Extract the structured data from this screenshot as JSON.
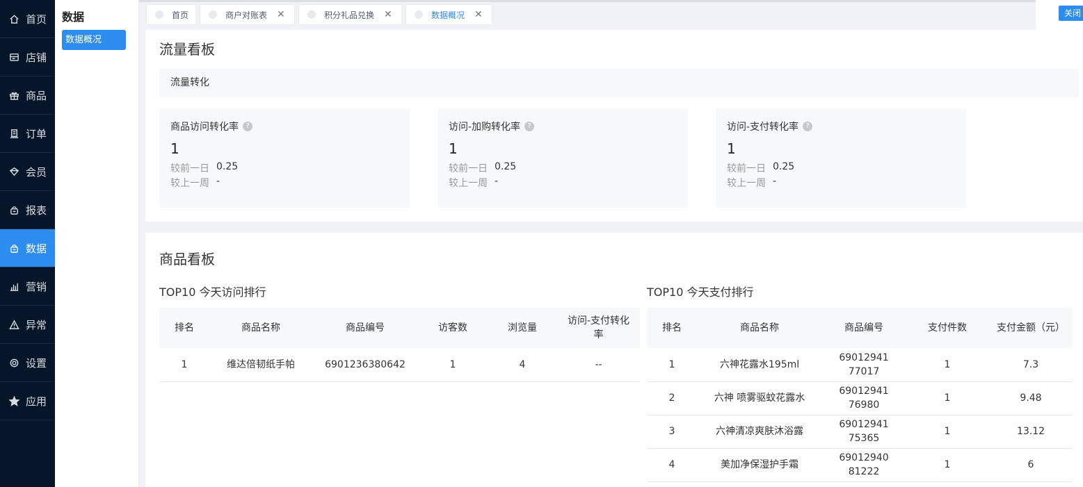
{
  "sidebar": {
    "items": [
      {
        "label": "首页",
        "icon": "home-icon"
      },
      {
        "label": "店铺",
        "icon": "store-icon"
      },
      {
        "label": "商品",
        "icon": "gift-icon"
      },
      {
        "label": "订单",
        "icon": "order-icon"
      },
      {
        "label": "会员",
        "icon": "member-icon"
      },
      {
        "label": "报表",
        "icon": "report-icon"
      },
      {
        "label": "数据",
        "icon": "data-icon",
        "active": true
      },
      {
        "label": "营销",
        "icon": "chart-bar-icon"
      },
      {
        "label": "异常",
        "icon": "warning-icon"
      },
      {
        "label": "设置",
        "icon": "gear-icon"
      },
      {
        "label": "应用",
        "icon": "star-icon"
      }
    ]
  },
  "subsidebar": {
    "title": "数据",
    "items": [
      {
        "label": "数据概况",
        "active": true
      }
    ]
  },
  "tabs": [
    {
      "label": "首页",
      "closable": false
    },
    {
      "label": "商户对账表",
      "closable": true
    },
    {
      "label": "积分礼品兑换",
      "closable": true
    },
    {
      "label": "数据概况",
      "closable": true,
      "active": true
    }
  ],
  "close_all_label": "关闭",
  "flow_board": {
    "title": "流量看板",
    "section_label": "流量转化",
    "cards": [
      {
        "name": "商品访问转化率",
        "value": "1",
        "prev_day_label": "较前一日",
        "prev_day_value": "0.25",
        "prev_week_label": "较上一周",
        "prev_week_value": "-"
      },
      {
        "name": "访问-加购转化率",
        "value": "1",
        "prev_day_label": "较前一日",
        "prev_day_value": "0.25",
        "prev_week_label": "较上一周",
        "prev_week_value": "-"
      },
      {
        "name": "访问-支付转化率",
        "value": "1",
        "prev_day_label": "较前一日",
        "prev_day_value": "0.25",
        "prev_week_label": "较上一周",
        "prev_week_value": "-"
      }
    ]
  },
  "product_board": {
    "title": "商品看板",
    "visit_rank": {
      "title": "TOP10 今天访问排行",
      "headers": [
        "排名",
        "商品名称",
        "商品编号",
        "访客数",
        "浏览量",
        "访问-支付转化率"
      ],
      "rows": [
        [
          "1",
          "维达倍韧纸手帕",
          "6901236380642",
          "1",
          "4",
          "--"
        ]
      ]
    },
    "pay_rank": {
      "title": "TOP10 今天支付排行",
      "headers": [
        "排名",
        "商品名称",
        "商品编号",
        "支付件数",
        "支付金额（元）"
      ],
      "rows": [
        [
          "1",
          "六神花露水195ml",
          "6901294177017",
          "1",
          "7.3"
        ],
        [
          "2",
          "六神 喷雾驱蚊花露水",
          "6901294176980",
          "1",
          "9.48"
        ],
        [
          "3",
          "六神清凉爽肤沐浴露",
          "6901294175365",
          "1",
          "13.12"
        ],
        [
          "4",
          "美加净保湿护手霜",
          "6901294081222",
          "1",
          "6"
        ]
      ]
    }
  }
}
